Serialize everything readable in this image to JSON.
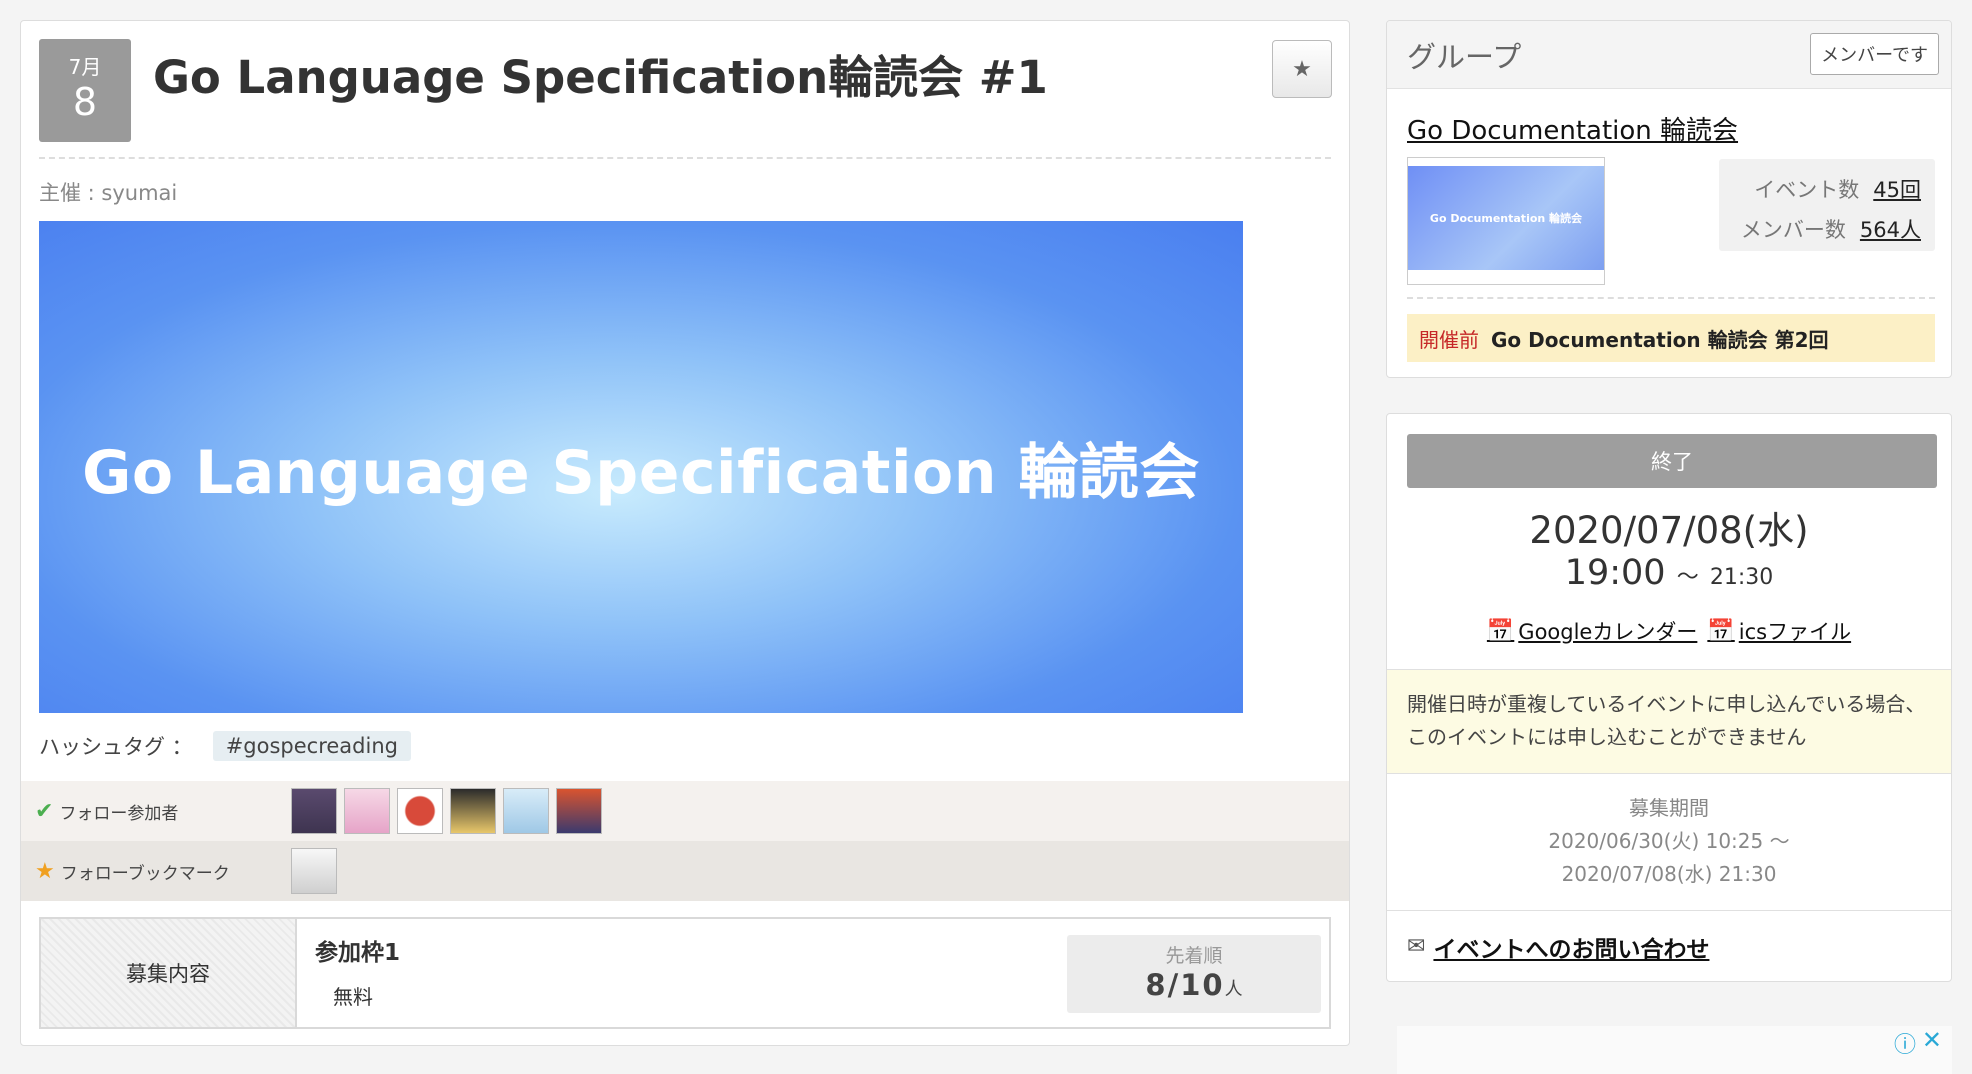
{
  "event": {
    "month": "7月",
    "day": "8",
    "title": "Go Language Specification輪読会 #1",
    "bookmark_icon": "★",
    "organizer": "主催 : syumai",
    "banner_text": "Go Language Specification 輪読会",
    "hashtag_label": "ハッシュタグ ：",
    "hashtag": "#gospecreading",
    "follow_participants_label": "フォロー参加者",
    "follow_bookmarks_label": "フォローブックマーク",
    "recruit": {
      "header": "募集内容",
      "slot_title": "参加枠1",
      "fee": "無料",
      "order_label": "先着順",
      "count": "8/10",
      "count_unit": "人"
    }
  },
  "group": {
    "header": "グループ",
    "member_button": "メンバーです",
    "name": "Go Documentation 輪読会",
    "thumb_text": "Go Documentation 輪読会",
    "events_label": "イベント数",
    "events_value": "45回",
    "members_label": "メンバー数",
    "members_value": "564人",
    "next_tag": "開催前",
    "next_title": "Go Documentation 輪読会 第2回"
  },
  "schedule": {
    "status": "終了",
    "date": "2020/07/08(水)",
    "start": "19:00",
    "tilde": "～",
    "end": "21:30",
    "google_calendar": "Googleカレンダー",
    "ics_file": "icsファイル",
    "notice": "開催日時が重複しているイベントに申し込んでいる場合、このイベントには申し込むことができません",
    "period_label": "募集期間",
    "period_start": "2020/06/30(火) 10:25 ～",
    "period_end": "2020/07/08(水) 21:30",
    "contact": "イベントへのお問い合わせ"
  },
  "colors": {
    "accent_yellow": "#fcf0c6",
    "tag_red": "#c62828",
    "banner_blue": "#4a7ff0"
  }
}
